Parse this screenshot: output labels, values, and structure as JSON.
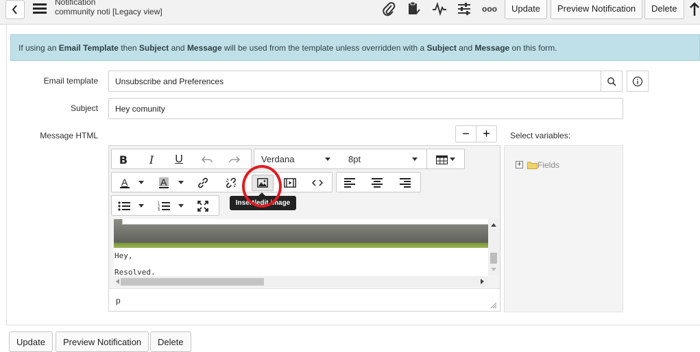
{
  "header": {
    "record_type": "Notification",
    "record_name": "community noti [Legacy view]",
    "update_label": "Update",
    "preview_label": "Preview Notification",
    "delete_label": "Delete",
    "more_label": "ooo"
  },
  "info": {
    "parts": [
      {
        "text": "If using an ",
        "bold": false
      },
      {
        "text": "Email Template",
        "bold": true
      },
      {
        "text": " then ",
        "bold": false
      },
      {
        "text": "Subject",
        "bold": true
      },
      {
        "text": " and ",
        "bold": false
      },
      {
        "text": "Message",
        "bold": true
      },
      {
        "text": " will be used from the template unless overridden with a ",
        "bold": false
      },
      {
        "text": "Subject",
        "bold": true
      },
      {
        "text": " and ",
        "bold": false
      },
      {
        "text": "Message",
        "bold": true
      },
      {
        "text": " on this form.",
        "bold": false
      }
    ]
  },
  "form": {
    "email_template_label": "Email template",
    "email_template_value": "Unsubscribe and Preferences",
    "subject_label": "Subject",
    "subject_value": "Hey comunity",
    "message_label": "Message HTML"
  },
  "editor": {
    "font_family": "Verdana",
    "font_size": "8pt",
    "tooltip": "Insert/edit image",
    "content_lines": [
      "Hey,",
      "Resolved."
    ],
    "path": "p",
    "minus": "−",
    "plus": "+"
  },
  "variables": {
    "label": "Select variables:",
    "fields_label": "Fields"
  },
  "footer": {
    "update_label": "Update",
    "preview_label": "Preview Notification",
    "delete_label": "Delete"
  },
  "colors": {
    "info_bg": "#bfe0e8",
    "highlight": "#e01a22"
  }
}
